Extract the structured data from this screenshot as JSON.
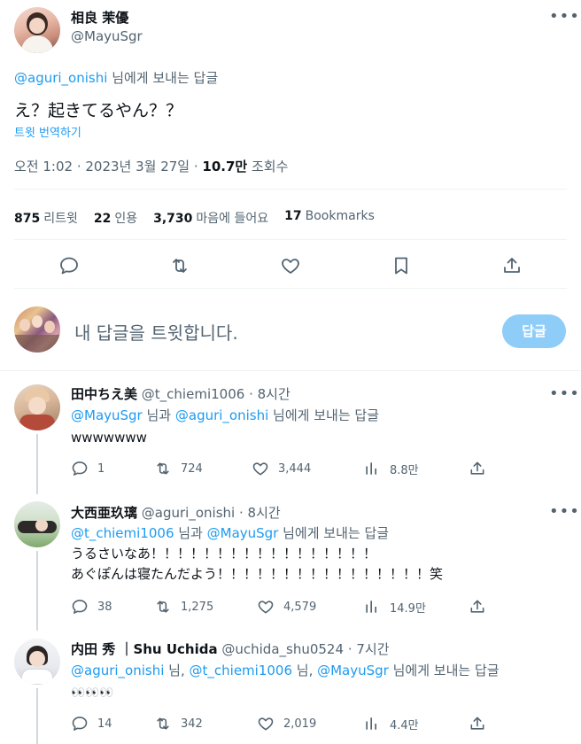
{
  "tweet": {
    "author_name": "相良 茉優",
    "author_handle": "@MayuSgr",
    "reply_to_handle": "@aguri_onishi",
    "reply_to_suffix": "님에게 보내는 답글",
    "text": "え？起きてるやん？？",
    "translate_label": "트윗 번역하기",
    "timestamp": "오전 1:02 · 2023년 3월 27일 · ",
    "views_count": "10.7만",
    "views_label": "조회수",
    "stats": {
      "retweets_count": "875",
      "retweets_label": "리트윗",
      "quotes_count": "22",
      "quotes_label": "인용",
      "likes_count": "3,730",
      "likes_label": "마음에 들어요",
      "bookmarks_count": "17",
      "bookmarks_label": "Bookmarks"
    }
  },
  "composer": {
    "placeholder": "내 답글을 트윗합니다.",
    "reply_button": "답글"
  },
  "replies": [
    {
      "name": "田中ちえ美",
      "handle": "@t_chiemi1006",
      "time": "· 8시간",
      "mention_1": "@MayuSgr",
      "mention_mid": " 님과 ",
      "mention_2": "@aguri_onishi",
      "mention_suffix": " 님에게 보내는 답글",
      "line_1": "wwwwwww",
      "replies": "1",
      "retweets": "724",
      "likes": "3,444",
      "views": "8.8만"
    },
    {
      "name": "大西亜玖璃",
      "handle": "@aguri_onishi",
      "time": "· 8시간",
      "mention_1": "@t_chiemi1006",
      "mention_mid": " 님과 ",
      "mention_2": "@MayuSgr",
      "mention_suffix": " 님에게 보내는 답글",
      "line_1": "うるさいなあ！！！！！！！！！！！！！！！！！",
      "line_2": "あぐぽんは寝たんだよう！！！！！！！！！！！！！！！！笑",
      "replies": "38",
      "retweets": "1,275",
      "likes": "4,579",
      "views": "14.9만"
    },
    {
      "name": "内田 秀 ｜Shu Uchida",
      "handle": "@uchida_shu0524",
      "time": "· 7시간",
      "mention_1": "@aguri_onishi",
      "sep_1": " 님, ",
      "mention_2": "@t_chiemi1006",
      "sep_2": " 님, ",
      "mention_3": "@MayuSgr",
      "mention_suffix": " 님에게 보내는 답글",
      "line_1": "👀👀👀",
      "replies": "14",
      "retweets": "342",
      "likes": "2,019",
      "views": "4.4만"
    }
  ],
  "colors": {
    "accent": "#1d9bf0",
    "reply_button_bg": "#8ecdf8",
    "muted": "#536471",
    "divider": "#eff3f4"
  },
  "icons": [
    "reply-icon",
    "retweet-icon",
    "like-icon",
    "bookmark-icon",
    "share-icon",
    "views-icon",
    "more-icon"
  ]
}
